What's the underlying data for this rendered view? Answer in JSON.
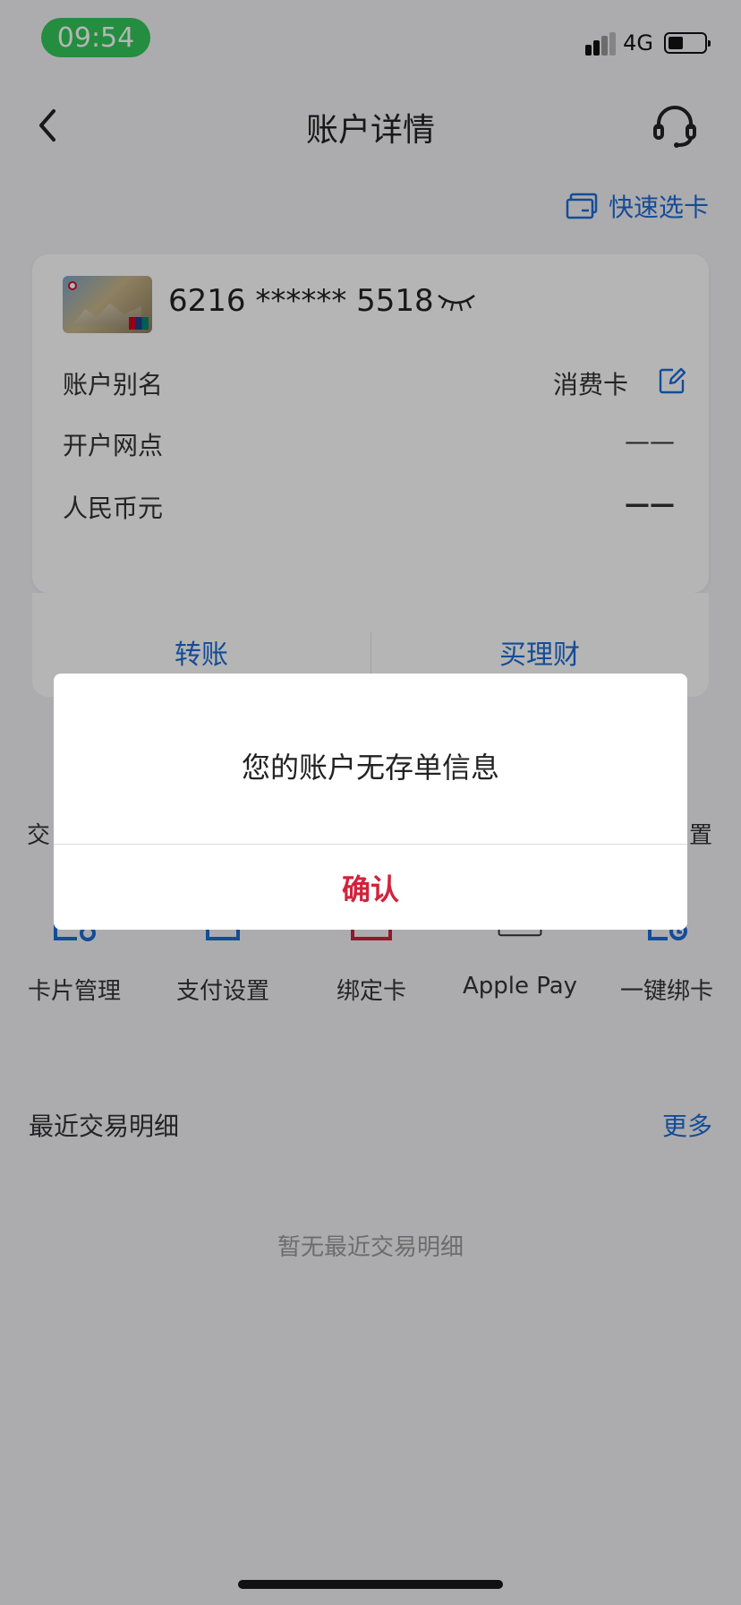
{
  "status_bar": {
    "time": "09:54",
    "network": "4G"
  },
  "nav": {
    "title": "账户详情"
  },
  "quick_select": {
    "label": "快速选卡"
  },
  "account": {
    "card_number": "6216 ****** 5518",
    "rows": [
      {
        "label": "账户别名",
        "value": "消费卡"
      },
      {
        "label": "开户网点",
        "value": "——"
      },
      {
        "label": "人民币元",
        "value": "——"
      }
    ]
  },
  "actions": [
    "转账",
    "买理财"
  ],
  "peek": {
    "left": "交",
    "right": "置"
  },
  "functions": [
    {
      "label": "卡片管理",
      "icon": "card-manage-icon"
    },
    {
      "label": "支付设置",
      "icon": "payment-settings-icon"
    },
    {
      "label": "绑定卡",
      "icon": "bind-card-icon"
    },
    {
      "label": "Apple Pay",
      "icon": "apple-pay-icon"
    },
    {
      "label": "一键绑卡",
      "icon": "one-click-bind-icon"
    }
  ],
  "recent": {
    "title": "最近交易明细",
    "more": "更多",
    "empty": "暂无最近交易明细"
  },
  "dialog": {
    "message": "您的账户无存单信息",
    "confirm": "确认"
  },
  "colors": {
    "accent": "#1d6bd6",
    "confirm": "#d0233b",
    "time_pill": "#34c759"
  }
}
